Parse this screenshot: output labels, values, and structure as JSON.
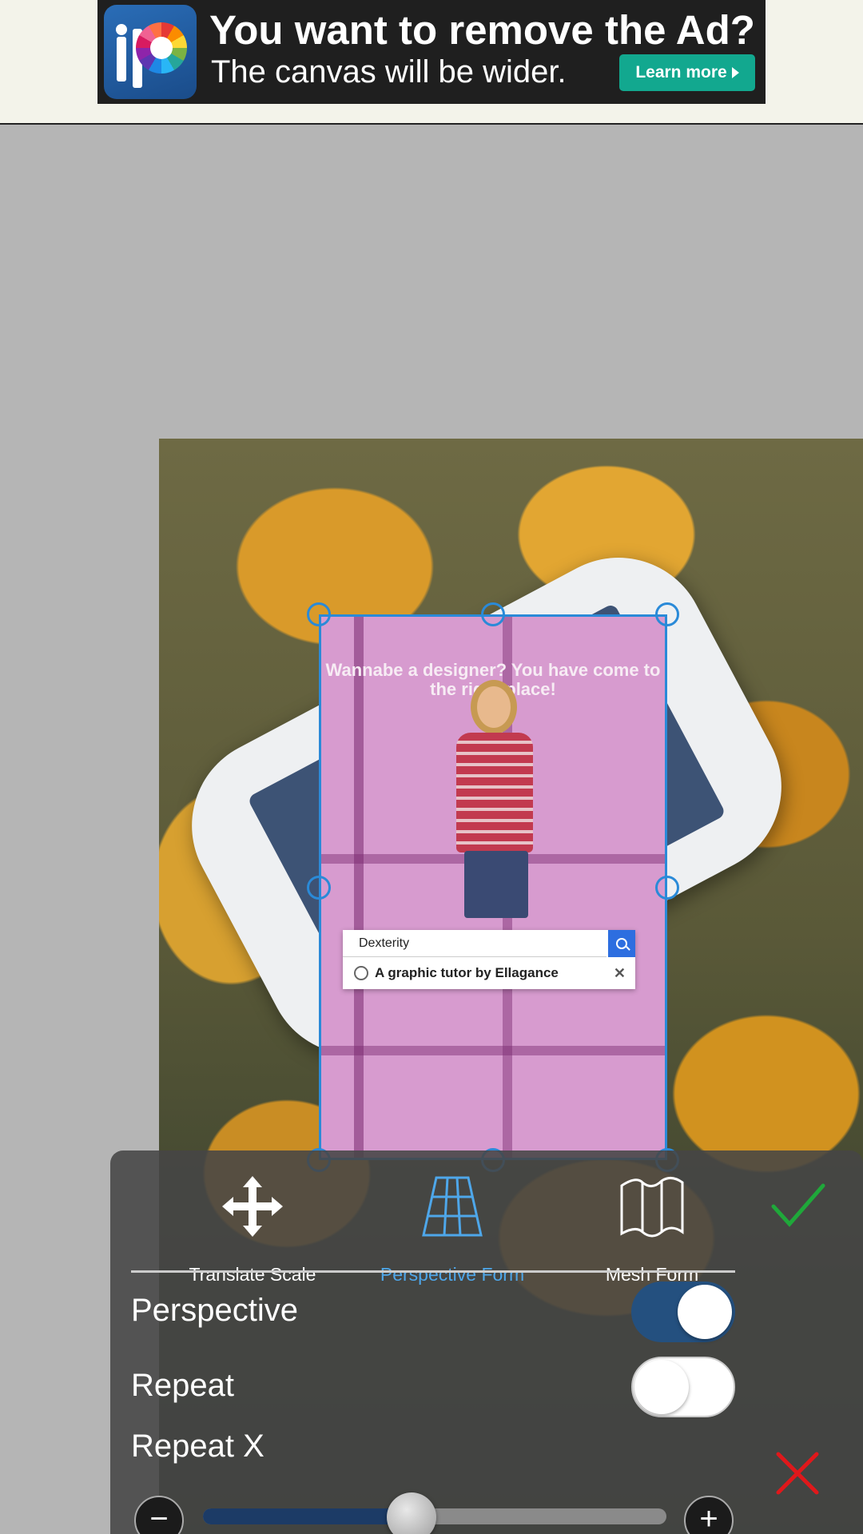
{
  "ad": {
    "title": "You want to remove the Ad?",
    "subtitle": "The canvas will be wider.",
    "button_label": "Learn more"
  },
  "layer": {
    "caption": "Wannabe a designer? You have come to the right place!",
    "search_value": "Dexterity",
    "suggestion": "A graphic tutor by Ellagance",
    "close_glyph": "✕"
  },
  "panel": {
    "tools": [
      {
        "label": "Translate Scale",
        "icon": "move-arrows-icon",
        "active": false
      },
      {
        "label": "Perspective Form",
        "icon": "perspective-grid-icon",
        "active": true
      },
      {
        "label": "Mesh Form",
        "icon": "mesh-map-icon",
        "active": false
      }
    ],
    "perspective_label": "Perspective",
    "perspective_on": true,
    "repeat_label": "Repeat",
    "repeat_on": false,
    "repeat_x_label": "Repeat X",
    "repeat_x_value": 0.45,
    "minus_glyph": "−",
    "plus_glyph": "+"
  },
  "colors": {
    "accent": "#4ea7ea",
    "confirm": "#1fa83a",
    "cancel": "#e0181b",
    "toggle_on": "#24507f"
  }
}
